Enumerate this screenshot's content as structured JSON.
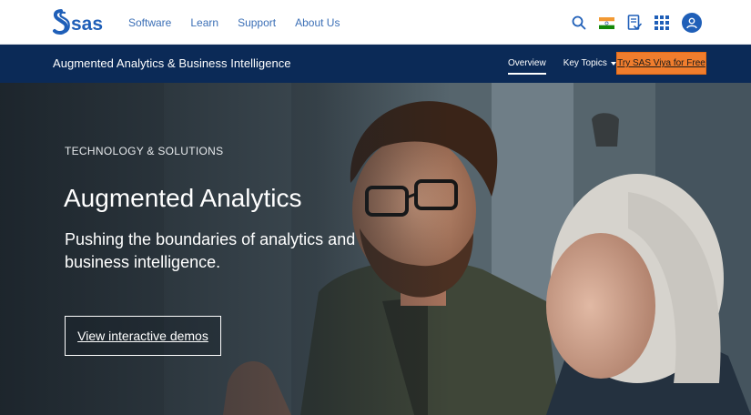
{
  "header": {
    "brand": "sas",
    "nav": [
      {
        "label": "Software"
      },
      {
        "label": "Learn"
      },
      {
        "label": "Support"
      },
      {
        "label": "About Us"
      }
    ],
    "utility_icons": [
      "search-icon",
      "india-flag-icon",
      "document-check-icon",
      "apps-grid-icon",
      "user-account-icon"
    ]
  },
  "subnav": {
    "section_title": "Augmented Analytics & Business Intelligence",
    "overview_label": "Overview",
    "key_topics_label": "Key Topics",
    "cta_label": "Try SAS Viya for Free"
  },
  "hero": {
    "eyebrow": "TECHNOLOGY & SOLUTIONS",
    "headline": "Augmented Analytics",
    "subhead": "Pushing the boundaries of analytics and business intelligence.",
    "button_label": "View interactive demos"
  },
  "colors": {
    "brand_blue": "#1f5fb8",
    "nav_link": "#3b6fb6",
    "subbar_bg": "#0b2a57",
    "cta_orange": "#f07d2d"
  }
}
